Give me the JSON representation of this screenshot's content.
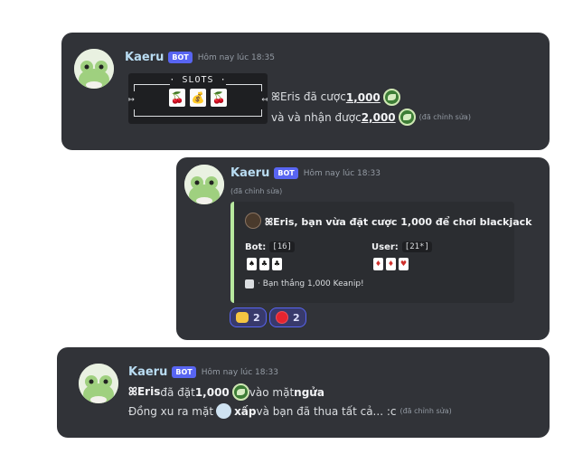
{
  "messages": [
    {
      "username": "Kaeru",
      "bot_tag": "BOT",
      "timestamp": "Hôm nay lúc 18:35",
      "slots": {
        "title": "· SLOTS ·",
        "reels": [
          "🍒",
          "💰",
          "🍒"
        ],
        "arrow_left": "↦",
        "arrow_right": "↤"
      },
      "line1_pre": "ꕤEris đã cược ",
      "line1_amount": "1,000",
      "line2_pre": "và và nhận được ",
      "line2_amount": "2,000",
      "edited": "(đã chỉnh sửa)"
    },
    {
      "username": "Kaeru",
      "bot_tag": "BOT",
      "timestamp": "Hôm nay lúc 18:33",
      "edited": "(đã chỉnh sửa)",
      "embed": {
        "title": "ꕤEris, bạn vừa đặt cược 1,000 để chơi blackjack",
        "bot_label": "Bot:",
        "bot_score": "[16]",
        "bot_cards": [
          "♠",
          "♣",
          "♣"
        ],
        "user_label": "User:",
        "user_score": "[21*]",
        "user_cards": [
          "♦",
          "♦",
          "♥"
        ],
        "footer": "· Bạn thắng 1,000 Keanip!",
        "accent": "#b7e89e"
      },
      "reactions": [
        {
          "icon": "fist-icon",
          "count": "2"
        },
        {
          "icon": "red-circle-icon",
          "count": "2"
        }
      ]
    },
    {
      "username": "Kaeru",
      "bot_tag": "BOT",
      "timestamp": "Hôm nay lúc 18:33",
      "line1_pre": "ꕤEris",
      "line1_mid": " đã đặt ",
      "line1_amount": "1,000",
      "line1_post": " vào mặt ",
      "line1_side": "ngửa",
      "line2_pre": "Đồng xu ra mặt ",
      "line2_side": "xấp",
      "line2_post": " và bạn đã thua tất cả... :c",
      "edited": "(đã chỉnh sửa)"
    }
  ],
  "colors": {
    "card_bg": "#313338",
    "bot_tag": "#5865f2",
    "username": "#b9dcf2",
    "coin": "#3d7d36"
  }
}
